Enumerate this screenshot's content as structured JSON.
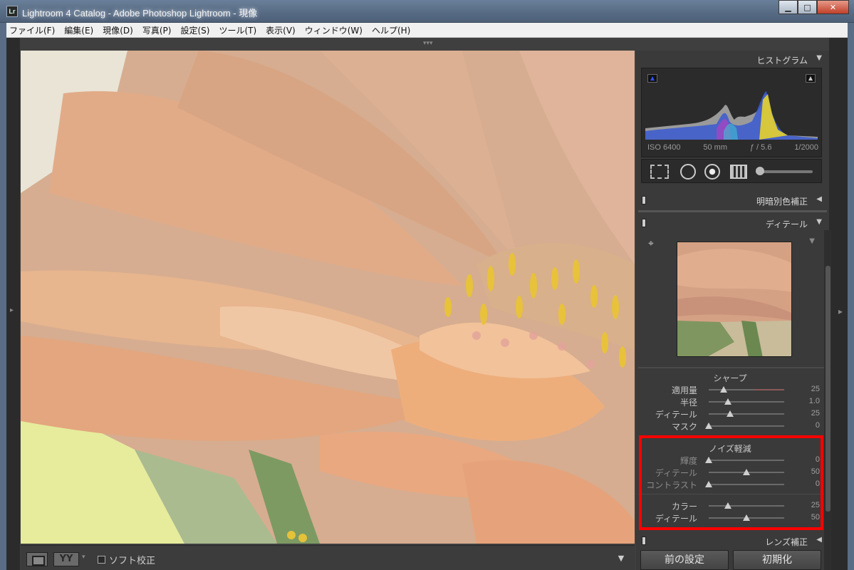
{
  "window": {
    "title": "Lightroom 4 Catalog - Adobe Photoshop Lightroom - 現像",
    "app_icon_text": "Lr",
    "minimize": "▁",
    "maximize": "□",
    "close": "✕"
  },
  "menu": [
    "ファイル(F)",
    "編集(E)",
    "現像(D)",
    "写真(P)",
    "設定(S)",
    "ツール(T)",
    "表示(V)",
    "ウィンドウ(W)",
    "ヘルプ(H)"
  ],
  "toolbar": {
    "yy_label": "YY",
    "soft_proof_label": "ソフト校正"
  },
  "panel": {
    "histogram": {
      "title": "ヒストグラム",
      "iso": "ISO 6400",
      "focal": "50 mm",
      "aperture": "ƒ / 5.6",
      "shutter": "1/2000"
    },
    "tone": {
      "title": "明暗別色補正"
    },
    "detail": {
      "title": "ディテール",
      "sharpen": {
        "title": "シャープ",
        "rows": [
          {
            "label": "適用量",
            "value": "25",
            "pos": 0.2
          },
          {
            "label": "半径",
            "value": "1.0",
            "pos": 0.25
          },
          {
            "label": "ディテール",
            "value": "25",
            "pos": 0.28
          },
          {
            "label": "マスク",
            "value": "0",
            "pos": 0.0
          }
        ]
      },
      "noise": {
        "title": "ノイズ軽減",
        "rows": [
          {
            "label": "輝度",
            "value": "0",
            "pos": 0.0
          },
          {
            "label": "ディテール",
            "value": "50",
            "pos": 0.5
          },
          {
            "label": "コントラスト",
            "value": "0",
            "pos": 0.0
          }
        ],
        "color_rows": [
          {
            "label": "カラー",
            "value": "25",
            "pos": 0.25
          },
          {
            "label": "ディテール",
            "value": "50",
            "pos": 0.5
          }
        ]
      }
    },
    "lens": {
      "title": "レンズ補正"
    },
    "buttons": {
      "previous": "前の設定",
      "reset": "初期化"
    }
  },
  "colors": {
    "highlight": "#ff0000",
    "panel_bg": "#3a3a3a"
  }
}
